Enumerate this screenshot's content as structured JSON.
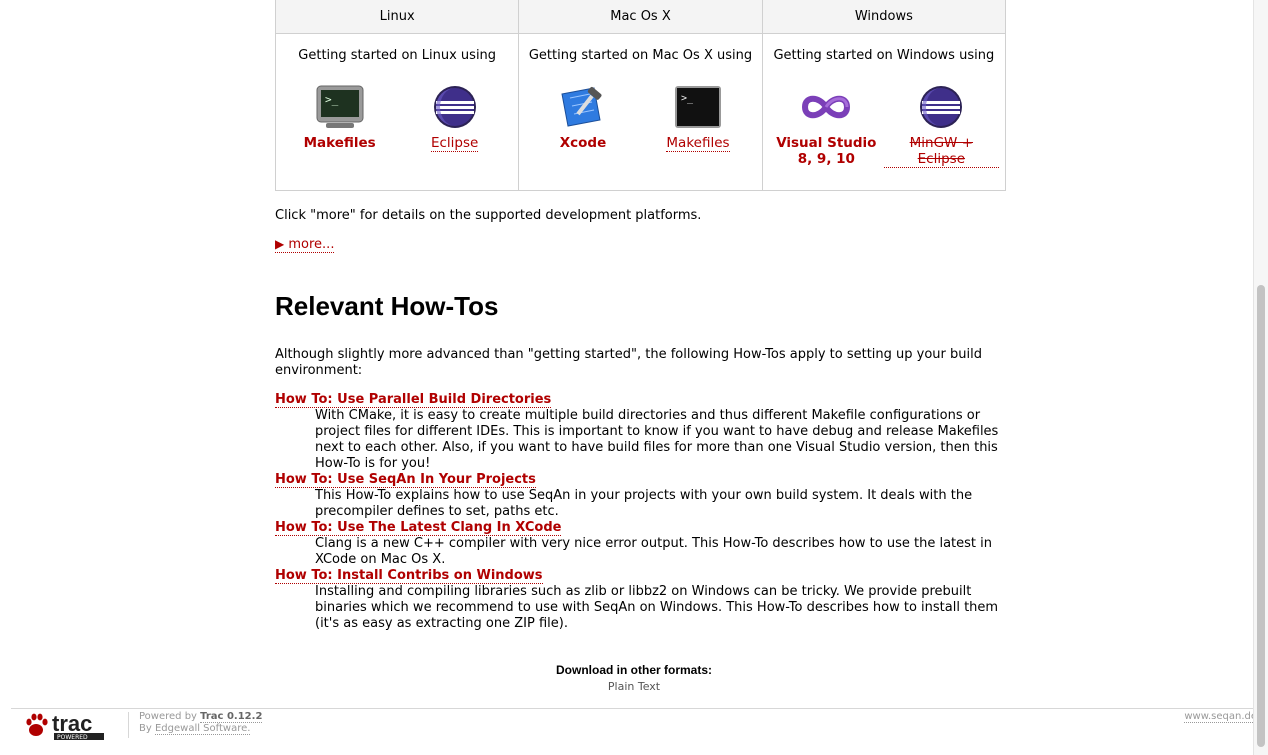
{
  "platforms": [
    {
      "name": "Linux",
      "intro": "Getting started on Linux using",
      "tools": [
        {
          "label": "Makefiles",
          "icon": "terminal-icon"
        },
        {
          "label": "Eclipse",
          "icon": "eclipse-icon"
        }
      ]
    },
    {
      "name": "Mac Os X",
      "intro": "Getting started on Mac Os X using",
      "tools": [
        {
          "label": "Xcode",
          "icon": "xcode-icon"
        },
        {
          "label": "Makefiles",
          "icon": "terminal-icon"
        }
      ]
    },
    {
      "name": "Windows",
      "intro": "Getting started on Windows using",
      "tools": [
        {
          "label": "Visual Studio 8, 9, 10",
          "icon": "visual-studio-icon"
        },
        {
          "label": "MinGW + Eclipse",
          "icon": "eclipse-icon"
        }
      ]
    }
  ],
  "click_more": "Click \"more\" for details on the supported development platforms.",
  "more_label": "more...",
  "howtos_title": "Relevant How-Tos",
  "howtos_intro": "Although slightly more advanced than \"getting started\", the following How-Tos apply to setting up your build environment:",
  "howtos": [
    {
      "title": "How To: Use Parallel Build Directories",
      "desc": "With CMake, it is easy to create multiple build directories and thus different Makefile configurations or project files for different IDEs. This is important to know if you want to have debug and release Makefiles next to each other. Also, if you want to have build files for more than one Visual Studio version, then this How-To is for you!"
    },
    {
      "title": "How To: Use SeqAn In Your Projects",
      "desc": "This How-To explains how to use SeqAn in your projects with your own build system. It deals with the precompiler defines to set, paths etc."
    },
    {
      "title": "How To: Use The Latest Clang In XCode",
      "desc": "Clang is a new C++ compiler with very nice error output. This How-To describes how to use the latest in XCode on Mac Os X."
    },
    {
      "title": "How To: Install Contribs on Windows",
      "desc": "Installing and compiling libraries such as zlib or libbz2 on Windows can be tricky. We provide prebuilt binaries which we recommend to use with SeqAn on Windows. This How-To describes how to install them (it's as easy as extracting one ZIP file)."
    }
  ],
  "download": {
    "heading": "Download in other formats:",
    "plain_text": "Plain Text"
  },
  "footer": {
    "logo_text": "trac",
    "logo_sub": "POWERED",
    "powered_by": "Powered by",
    "trac_version": "Trac 0.12.2",
    "by": "By",
    "edgewall": "Edgewall Software.",
    "site": "www.seqan.de"
  },
  "colors": {
    "link": "#b00000"
  }
}
